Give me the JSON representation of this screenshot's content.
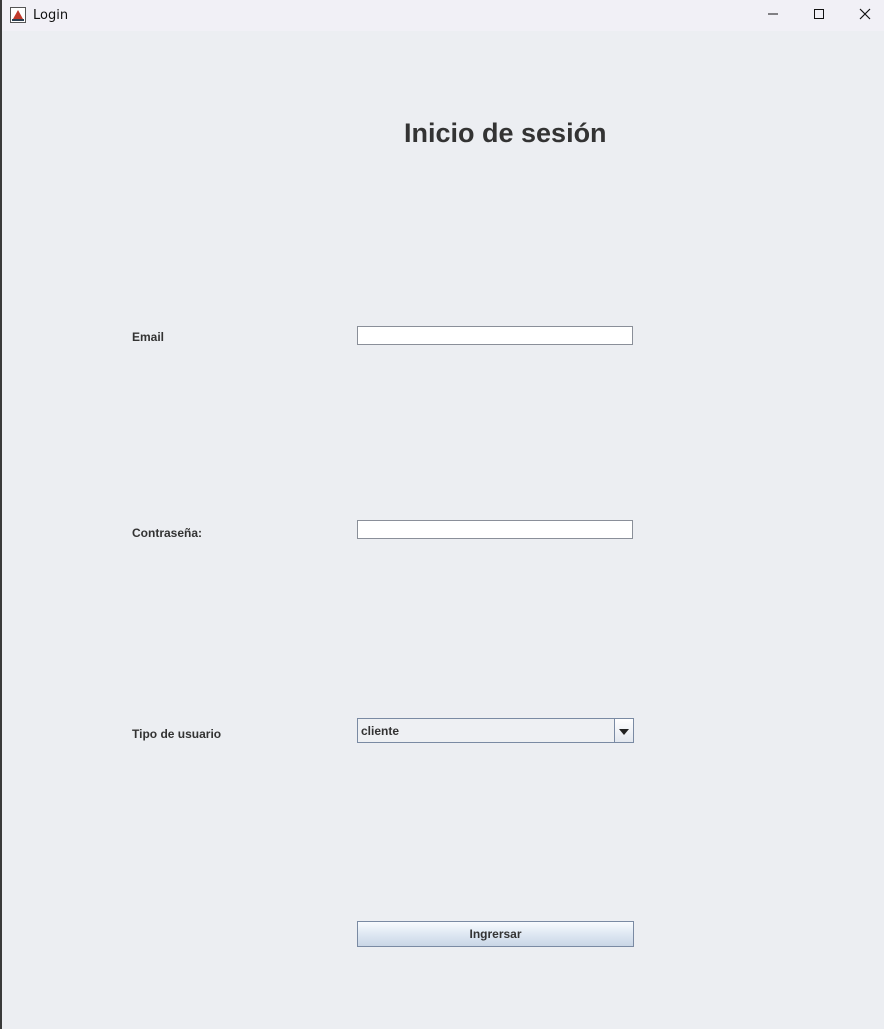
{
  "window": {
    "title": "Login",
    "app_icon": "java-app-icon",
    "controls": {
      "minimize_icon": "minimize-icon",
      "maximize_icon": "maximize-icon",
      "close_icon": "close-icon"
    }
  },
  "form": {
    "heading": "Inicio de sesión",
    "email_label": "Email",
    "email_value": "",
    "password_label": "Contraseña:",
    "password_value": "",
    "user_type_label": "Tipo de usuario",
    "user_type_selected": "cliente",
    "submit_label": "Ingrersar"
  },
  "colors": {
    "background": "#eceef2",
    "text": "#333333",
    "border": "#7a8aa3"
  }
}
